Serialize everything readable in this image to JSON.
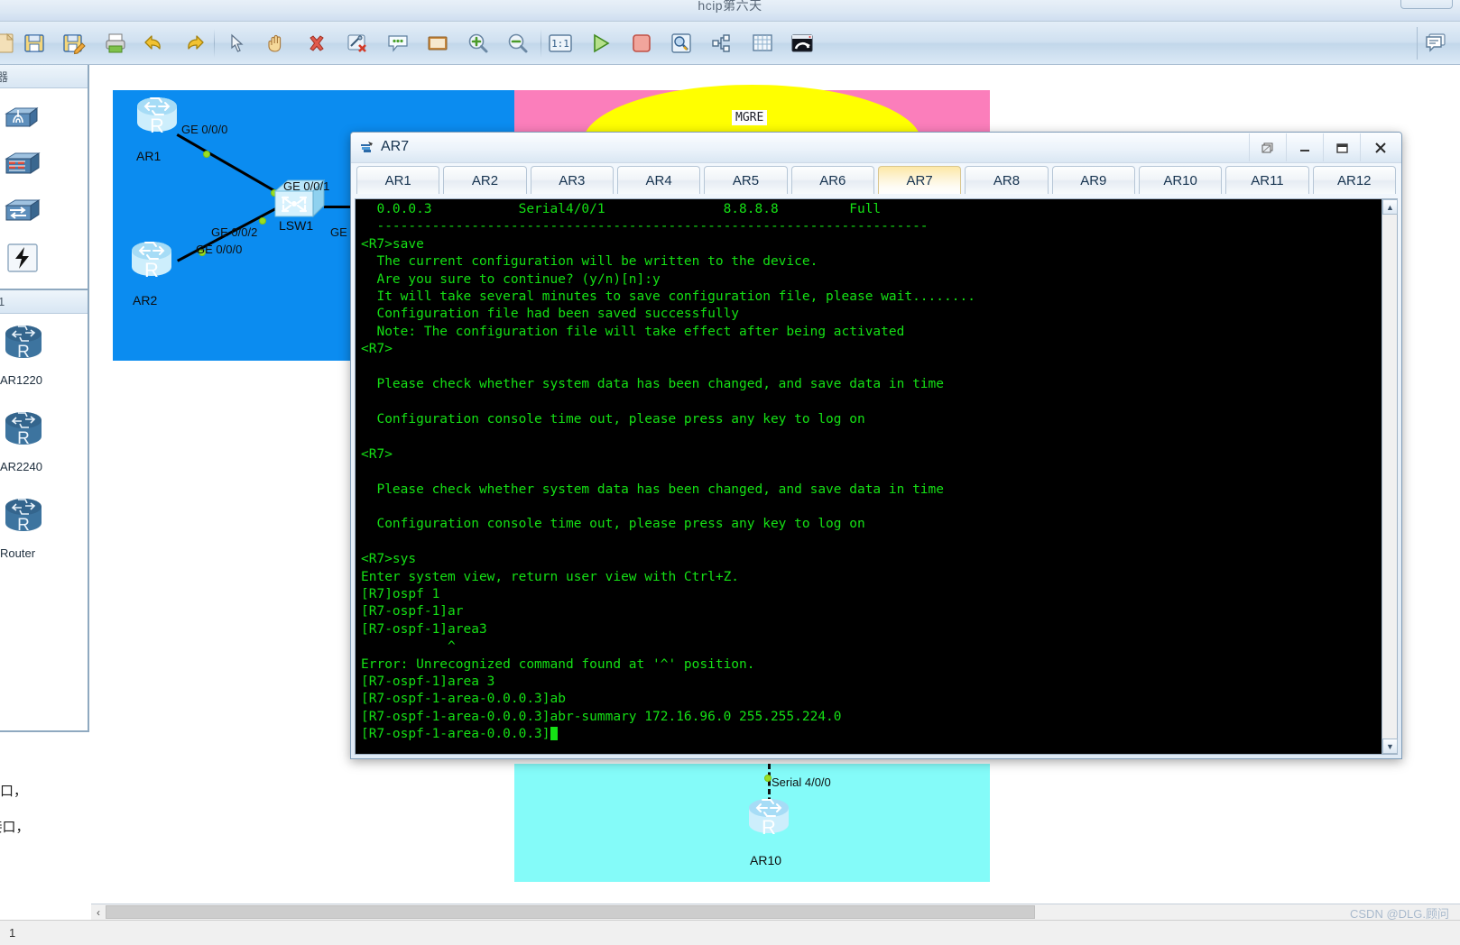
{
  "app": {
    "title": "hcip第六天",
    "toolbar_icons": [
      "new-file-icon",
      "save-icon",
      "save-as-icon",
      "print-icon",
      "undo-icon",
      "redo-icon",
      "select-pointer-icon",
      "pan-hand-icon",
      "delete-icon",
      "delete-link-icon",
      "comment-icon",
      "note-icon",
      "zoom-in-icon",
      "zoom-out-icon",
      "zoom-actual-size-icon",
      "start-all-icon",
      "stop-all-icon",
      "capture-packet-icon",
      "topology-tree-icon",
      "grid-icon",
      "restore-view-icon"
    ],
    "toolbar_right_icon": "chat-icon",
    "title_bar_button": "window-restore-button"
  },
  "sidebar": {
    "header_label": "器",
    "palette_icons": [
      "wireless-ap-icon",
      "firewall-icon",
      "multilayer-switch-icon",
      "lightning-icon"
    ],
    "section_label": "1",
    "devices": [
      {
        "icon": "router-icon",
        "label": "AR1220"
      },
      {
        "icon": "router-icon",
        "label": "AR2240"
      },
      {
        "icon": "router-icon",
        "label": "Router"
      }
    ],
    "footer_lines": [
      "口，",
      "k接口，"
    ]
  },
  "canvas": {
    "zones": [
      {
        "name": "blue-zone",
        "color": "#0b8cf0"
      },
      {
        "name": "pink-zone",
        "color": "#fb7ebb"
      },
      {
        "name": "yellow-dome",
        "color": "#ffff00"
      },
      {
        "name": "cyan-zone",
        "color": "#84fbf9"
      }
    ],
    "mgre_label": "MGRE",
    "devices": [
      {
        "name": "AR1",
        "type": "router"
      },
      {
        "name": "AR2",
        "type": "router"
      },
      {
        "name": "LSW1",
        "type": "switch"
      },
      {
        "name": "AR10",
        "type": "router"
      }
    ],
    "port_labels": [
      "GE 0/0/0",
      "GE 0/0/1",
      "GE 0/0/2",
      "GE 0/0/0",
      "GE",
      "Serial 4/0/0"
    ],
    "hscroll": {
      "left_arrow": "‹",
      "right_arrow": "›"
    }
  },
  "console": {
    "window_title": "AR7",
    "window_icon": "console-device-icon",
    "title_buttons": [
      {
        "name": "restore-button",
        "glyph": "restore"
      },
      {
        "name": "minimize-button",
        "glyph": "minimize"
      },
      {
        "name": "maximize-button",
        "glyph": "maximize"
      },
      {
        "name": "close-button",
        "glyph": "X"
      }
    ],
    "tabs": [
      {
        "label": "AR1",
        "active": false
      },
      {
        "label": "AR2",
        "active": false
      },
      {
        "label": "AR3",
        "active": false
      },
      {
        "label": "AR4",
        "active": false
      },
      {
        "label": "AR5",
        "active": false
      },
      {
        "label": "AR6",
        "active": false
      },
      {
        "label": "AR7",
        "active": true
      },
      {
        "label": "AR8",
        "active": false
      },
      {
        "label": "AR9",
        "active": false
      },
      {
        "label": "AR10",
        "active": false
      },
      {
        "label": "AR11",
        "active": false
      },
      {
        "label": "AR12",
        "active": false
      }
    ],
    "terminal_text": "  0.0.0.3           Serial4/0/1               8.8.8.8         Full\n  ----------------------------------------------------------------------\n<R7>save\n  The current configuration will be written to the device.\n  Are you sure to continue? (y/n)[n]:y\n  It will take several minutes to save configuration file, please wait........\n  Configuration file had been saved successfully\n  Note: The configuration file will take effect after being activated\n<R7>\n\n  Please check whether system data has been changed, and save data in time\n\n  Configuration console time out, please press any key to log on\n\n<R7>\n\n  Please check whether system data has been changed, and save data in time\n\n  Configuration console time out, please press any key to log on\n\n<R7>sys\nEnter system view, return user view with Ctrl+Z.\n[R7]ospf 1\n[R7-ospf-1]ar\n[R7-ospf-1]area3\n           ^\nError: Unrecognized command found at '^' position.\n[R7-ospf-1]area 3\n[R7-ospf-1-area-0.0.0.3]ab\n[R7-ospf-1-area-0.0.0.3]abr-summary 172.16.96.0 255.255.224.0\n[R7-ospf-1-area-0.0.0.3]",
    "scroll_up": "▲",
    "scroll_down": "▼"
  },
  "statusbar": {
    "text": "1"
  },
  "watermark": {
    "text": "CSDN @DLG.顾问"
  },
  "colors": {
    "terminal_bg": "#000000",
    "terminal_fg": "#15e015",
    "zone_blue": "#0b8cf0",
    "zone_pink": "#fb7ebb",
    "zone_yellow": "#ffff00",
    "zone_cyan": "#84fbf9",
    "tab_active": "#fde8a6"
  }
}
